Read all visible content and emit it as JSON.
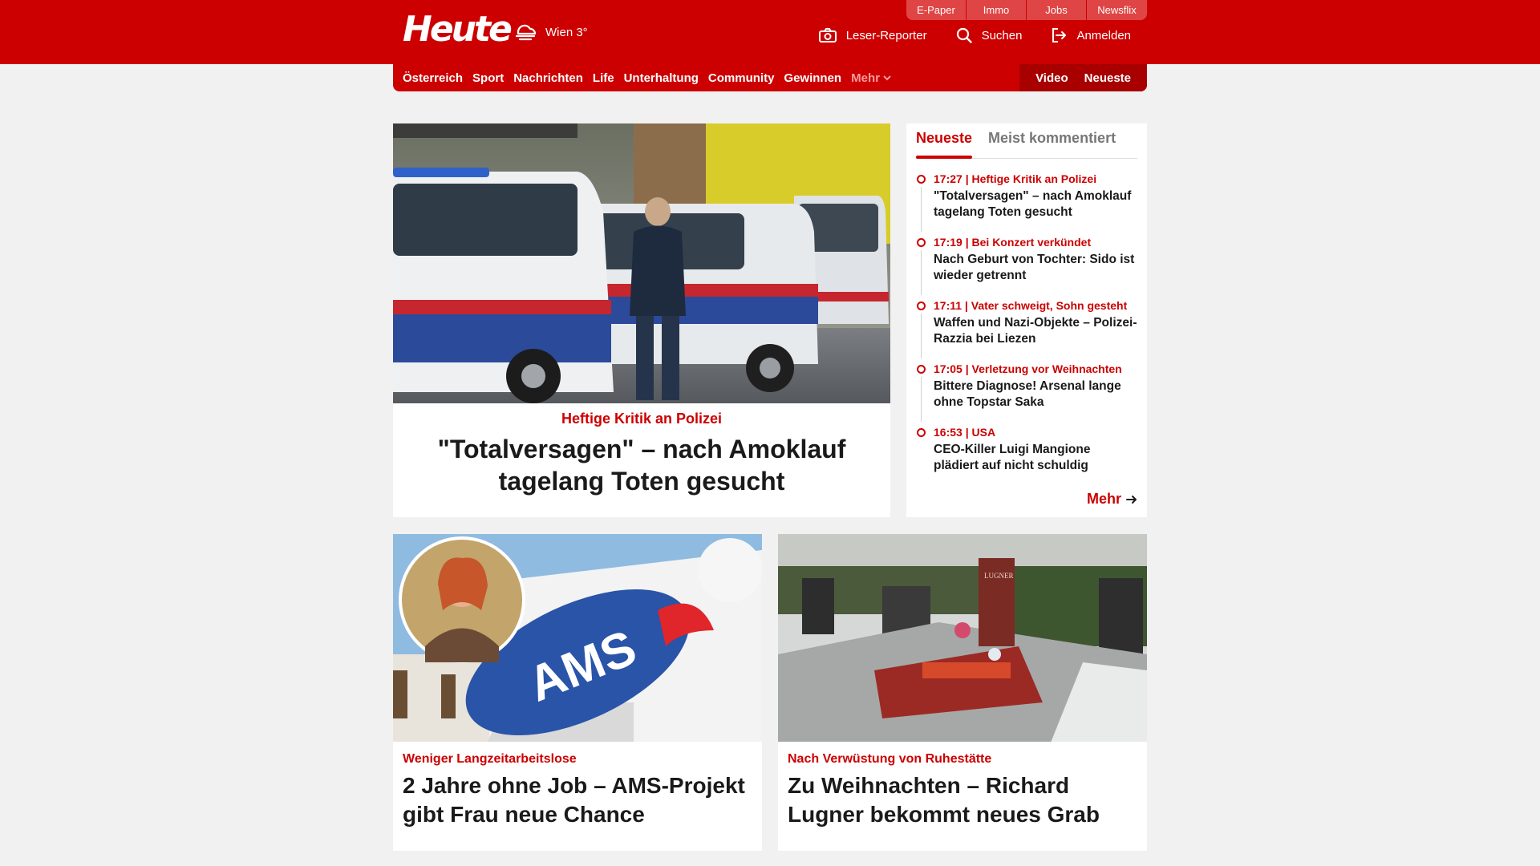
{
  "header": {
    "logo": "Heute",
    "weather": "Wien 3°",
    "services": [
      "E-Paper",
      "Immo",
      "Jobs",
      "Newsflix"
    ],
    "tools": {
      "reporter": "Leser-Reporter",
      "search": "Suchen",
      "login": "Anmelden"
    }
  },
  "nav": {
    "items": [
      "Österreich",
      "Sport",
      "Nachrichten",
      "Life",
      "Unterhaltung",
      "Community",
      "Gewinnen"
    ],
    "more": "Mehr",
    "right": [
      "Video",
      "Neueste"
    ]
  },
  "hero": {
    "kicker": "Heftige Kritik an Polizei",
    "title": "\"Totalversagen\" – nach Amoklauf tagelang Toten gesucht",
    "image": "Police vans with officer"
  },
  "sidebar": {
    "tabs": [
      "Neueste",
      "Meist kommentiert"
    ],
    "items": [
      {
        "time": "17:27",
        "kicker": "Heftige Kritik an Polizei",
        "title": "\"Totalversagen\" – nach Amoklauf tagelang Toten gesucht"
      },
      {
        "time": "17:19",
        "kicker": "Bei Konzert verkündet",
        "title": "Nach Geburt von Tochter: Sido ist wieder getrennt"
      },
      {
        "time": "17:11",
        "kicker": "Vater schweigt, Sohn gesteht",
        "title": "Waffen und Nazi-Objekte – Polizei-Razzia bei Liezen"
      },
      {
        "time": "17:05",
        "kicker": "Verletzung vor Weihnachten",
        "title": "Bittere Diagnose! Arsenal lange ohne Topstar Saka"
      },
      {
        "time": "16:53",
        "kicker": "USA",
        "title": "CEO-Killer Luigi Mangione plädiert auf nicht schuldig"
      }
    ],
    "more": "Mehr"
  },
  "cards": [
    {
      "kicker": "Weniger Langzeitarbeitslose",
      "title": "2 Jahre ohne Job – AMS-Projekt gibt Frau neue Chance",
      "logo_text": "AMS"
    },
    {
      "kicker": "Nach Verwüstung von Ruhestätte",
      "title": "Zu Weihnachten – Richard Lugner bekommt neues Grab",
      "tombstone_text": "LUGNER"
    }
  ],
  "colors": {
    "brand": "#cc0000",
    "background": "#f1f1f1"
  }
}
